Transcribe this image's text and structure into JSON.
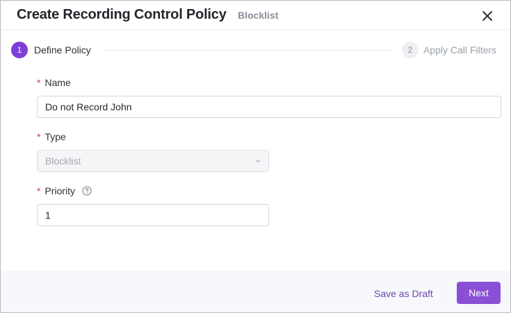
{
  "header": {
    "title": "Create Recording Control Policy",
    "subtitle": "Blocklist"
  },
  "steps": [
    {
      "number": "1",
      "label": "Define Policy",
      "state": "active"
    },
    {
      "number": "2",
      "label": "Apply Call Filters",
      "state": "inactive"
    }
  ],
  "form": {
    "required_mark": "*",
    "name": {
      "label": "Name",
      "value": "Do not Record John"
    },
    "type": {
      "label": "Type",
      "value": "Blocklist"
    },
    "priority": {
      "label": "Priority",
      "value": "1"
    }
  },
  "footer": {
    "draft_label": "Save as Draft",
    "next_label": "Next"
  },
  "colors": {
    "accent": "#8a4fd6",
    "required": "#d9363e"
  },
  "icons": {
    "close": "close-icon",
    "help": "help-circle-icon",
    "dropdown": "chevron-down-icon"
  }
}
